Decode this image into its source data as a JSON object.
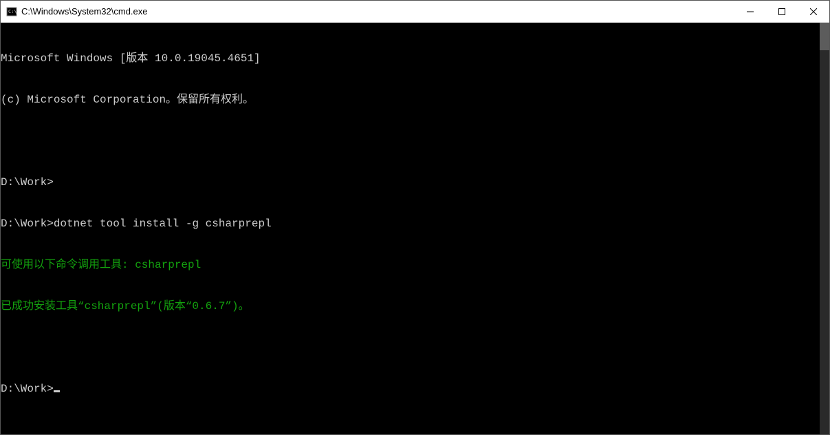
{
  "titlebar": {
    "title": "C:\\Windows\\System32\\cmd.exe"
  },
  "terminal": {
    "line1": "Microsoft Windows [版本 10.0.19045.4651]",
    "line2": "(c) Microsoft Corporation。保留所有权利。",
    "blank1": "",
    "prompt1": "D:\\Work>",
    "prompt2_prefix": "D:\\Work>",
    "prompt2_cmd": "dotnet tool install -g csharprepl",
    "msg1": "可使用以下命令调用工具: csharprepl",
    "msg2": "已成功安装工具“csharprepl”(版本“0.6.7”)。",
    "blank2": "",
    "prompt3": "D:\\Work>"
  }
}
